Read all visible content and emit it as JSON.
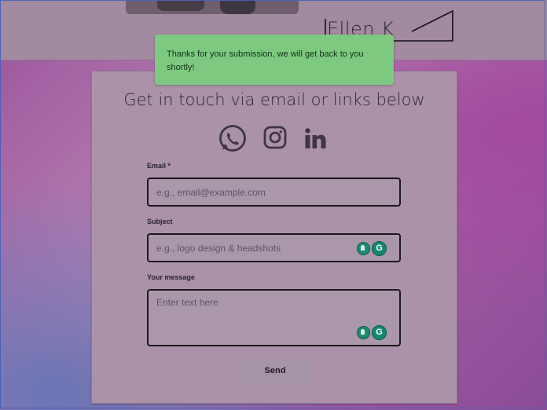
{
  "header": {
    "logo_text": "Ellen K Stone"
  },
  "toast": {
    "message": "Thanks for your submission, we will get back to you shortly!",
    "color": "#7dc980"
  },
  "contact": {
    "title": "Get in touch via email or links below",
    "social_icons": [
      "whatsapp-icon",
      "instagram-icon",
      "linkedin-icon"
    ],
    "fields": [
      {
        "label": "Email *",
        "placeholder": "e.g., email@example.com"
      },
      {
        "label": "Subject",
        "placeholder": "e.g., logo design & headshots"
      },
      {
        "label": "Your message",
        "placeholder": "Enter text here"
      }
    ],
    "send_label": "Send"
  }
}
